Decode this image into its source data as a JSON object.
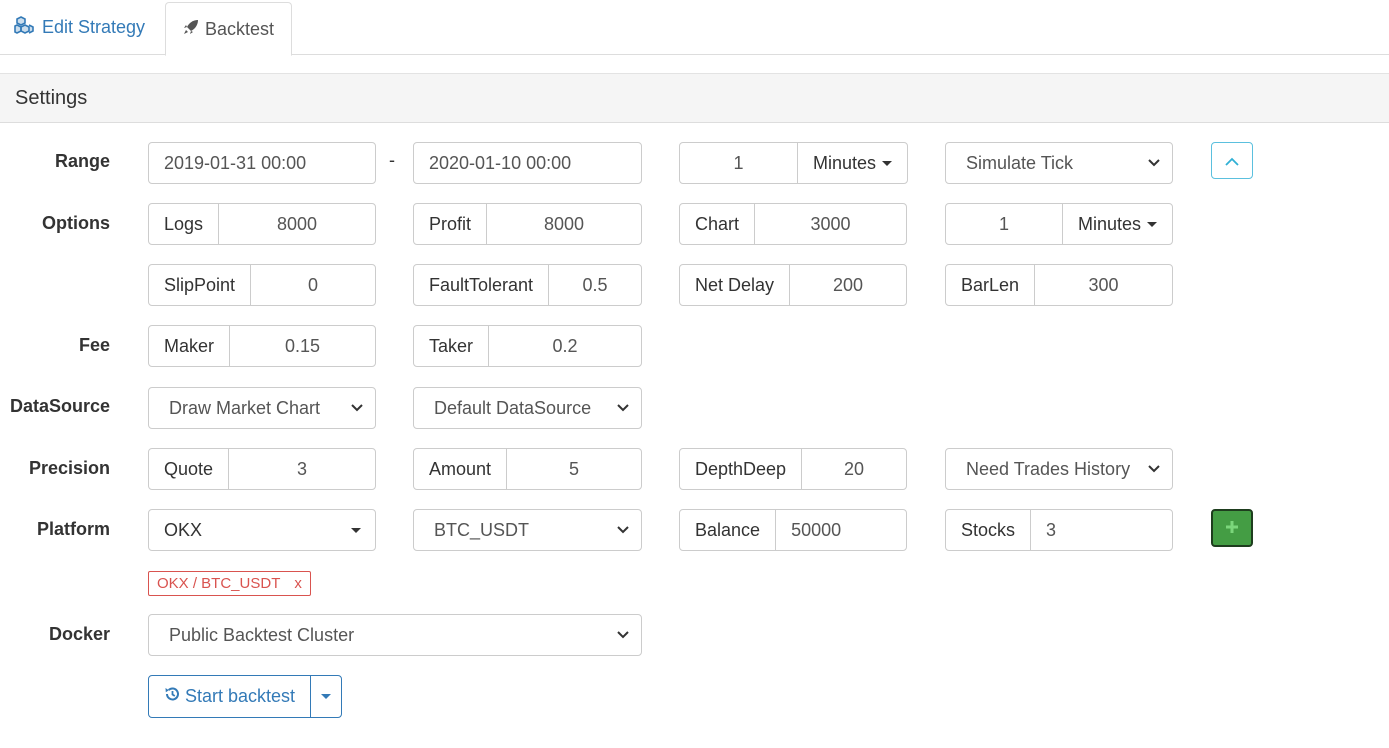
{
  "tabs": {
    "edit_strategy": "Edit Strategy",
    "backtest": "Backtest"
  },
  "panel": {
    "title": "Settings"
  },
  "labels": {
    "range": "Range",
    "options": "Options",
    "fee": "Fee",
    "datasource": "DataSource",
    "precision": "Precision",
    "platform": "Platform",
    "docker": "Docker"
  },
  "range": {
    "start": "2019-01-31 00:00",
    "separator": "-",
    "end": "2020-01-10 00:00",
    "period_value": "1",
    "period_unit": "Minutes",
    "mode": "Simulate Tick"
  },
  "options": {
    "logs_label": "Logs",
    "logs_value": "8000",
    "profit_label": "Profit",
    "profit_value": "8000",
    "chart_label": "Chart",
    "chart_value": "3000",
    "kline_value": "1",
    "kline_unit": "Minutes",
    "slippoint_label": "SlipPoint",
    "slippoint_value": "0",
    "faulttolerant_label": "FaultTolerant",
    "faulttolerant_value": "0.5",
    "netdelay_label": "Net Delay",
    "netdelay_value": "200",
    "barlen_label": "BarLen",
    "barlen_value": "300"
  },
  "fee": {
    "maker_label": "Maker",
    "maker_value": "0.15",
    "taker_label": "Taker",
    "taker_value": "0.2"
  },
  "datasource": {
    "chart_mode": "Draw Market Chart",
    "source": "Default DataSource"
  },
  "precision": {
    "quote_label": "Quote",
    "quote_value": "3",
    "amount_label": "Amount",
    "amount_value": "5",
    "depth_label": "DepthDeep",
    "depth_value": "20",
    "trades_history": "Need Trades History"
  },
  "platform": {
    "exchange": "OKX",
    "pair": "BTC_USDT",
    "balance_label": "Balance",
    "balance_value": "50000",
    "stocks_label": "Stocks",
    "stocks_value": "3",
    "tag_text": "OKX / BTC_USDT",
    "tag_remove": "x"
  },
  "docker": {
    "cluster": "Public Backtest Cluster"
  },
  "actions": {
    "start_backtest": "Start backtest"
  },
  "colors": {
    "link": "#337ab7",
    "danger": "#d9534f",
    "success": "#449d44",
    "info": "#5bc0de"
  },
  "icons": {
    "edit_strategy": "cubes-icon",
    "backtest": "rocket-icon",
    "collapse": "chevron-up-icon",
    "add": "plus-icon",
    "start": "history-icon"
  }
}
